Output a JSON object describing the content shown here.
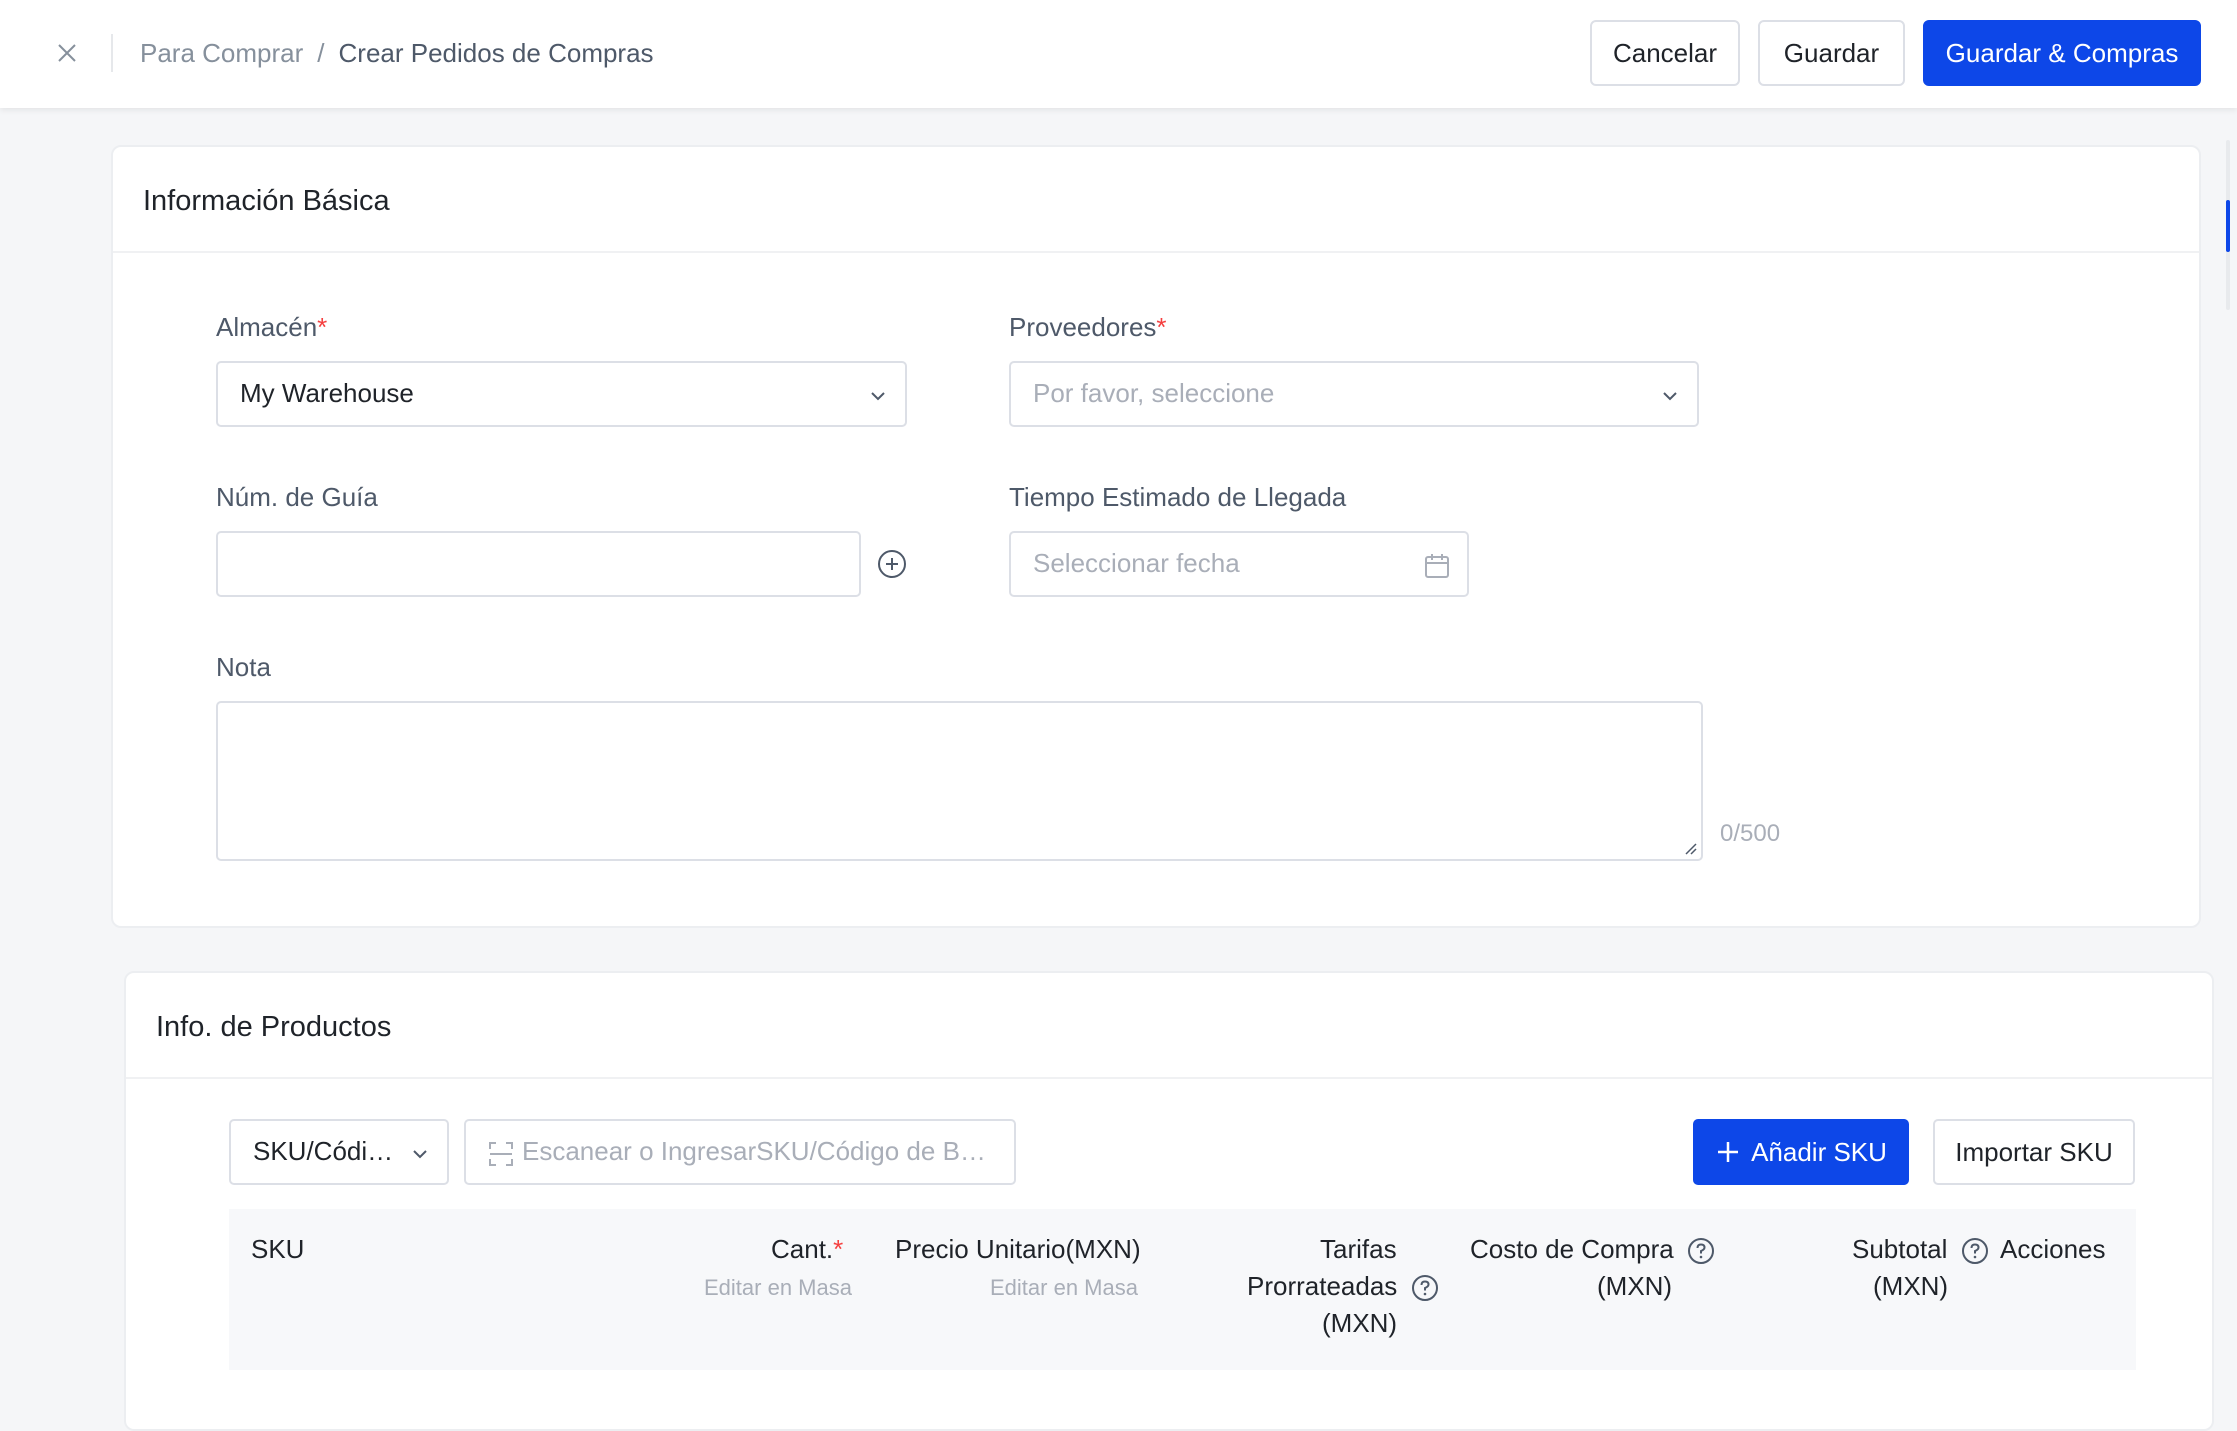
{
  "header": {
    "breadcrumb_parent": "Para Comprar",
    "breadcrumb_separator": "/",
    "breadcrumb_current": "Crear Pedidos de Compras",
    "cancel_label": "Cancelar",
    "save_label": "Guardar",
    "save_purchase_label": "Guardar & Compras"
  },
  "basic_info": {
    "title": "Información Básica",
    "warehouse": {
      "label": "Almacén",
      "value": "My Warehouse"
    },
    "supplier": {
      "label": "Proveedores",
      "placeholder": "Por favor, seleccione"
    },
    "tracking": {
      "label": "Núm. de Guía",
      "value": ""
    },
    "eta": {
      "label": "Tiempo Estimado de Llegada",
      "placeholder": "Seleccionar fecha"
    },
    "note": {
      "label": "Nota",
      "value": "",
      "counter": "0/500"
    },
    "required_mark": "*"
  },
  "products": {
    "title": "Info. de Productos",
    "search_type": "SKU/Códi…",
    "search_placeholder": "Escanear o IngresarSKU/Código de B…",
    "add_sku_label": "Añadir SKU",
    "import_sku_label": "Importar SKU",
    "columns": {
      "sku": "SKU",
      "qty": "Cant.",
      "qty_sub": "Editar en Masa",
      "unit_price": "Precio Unitario(MXN)",
      "unit_price_sub": "Editar en Masa",
      "fees_1": "Tarifas",
      "fees_2": "Prorrateadas",
      "fees_3": "(MXN)",
      "cost_1": "Costo de Compra",
      "cost_2": "(MXN)",
      "subtotal_1": "Subtotal",
      "subtotal_2": "(MXN)",
      "actions": "Acciones"
    }
  },
  "colors": {
    "primary": "#0d47e8",
    "required": "#f53f3f",
    "placeholder": "#a9aeb8"
  }
}
